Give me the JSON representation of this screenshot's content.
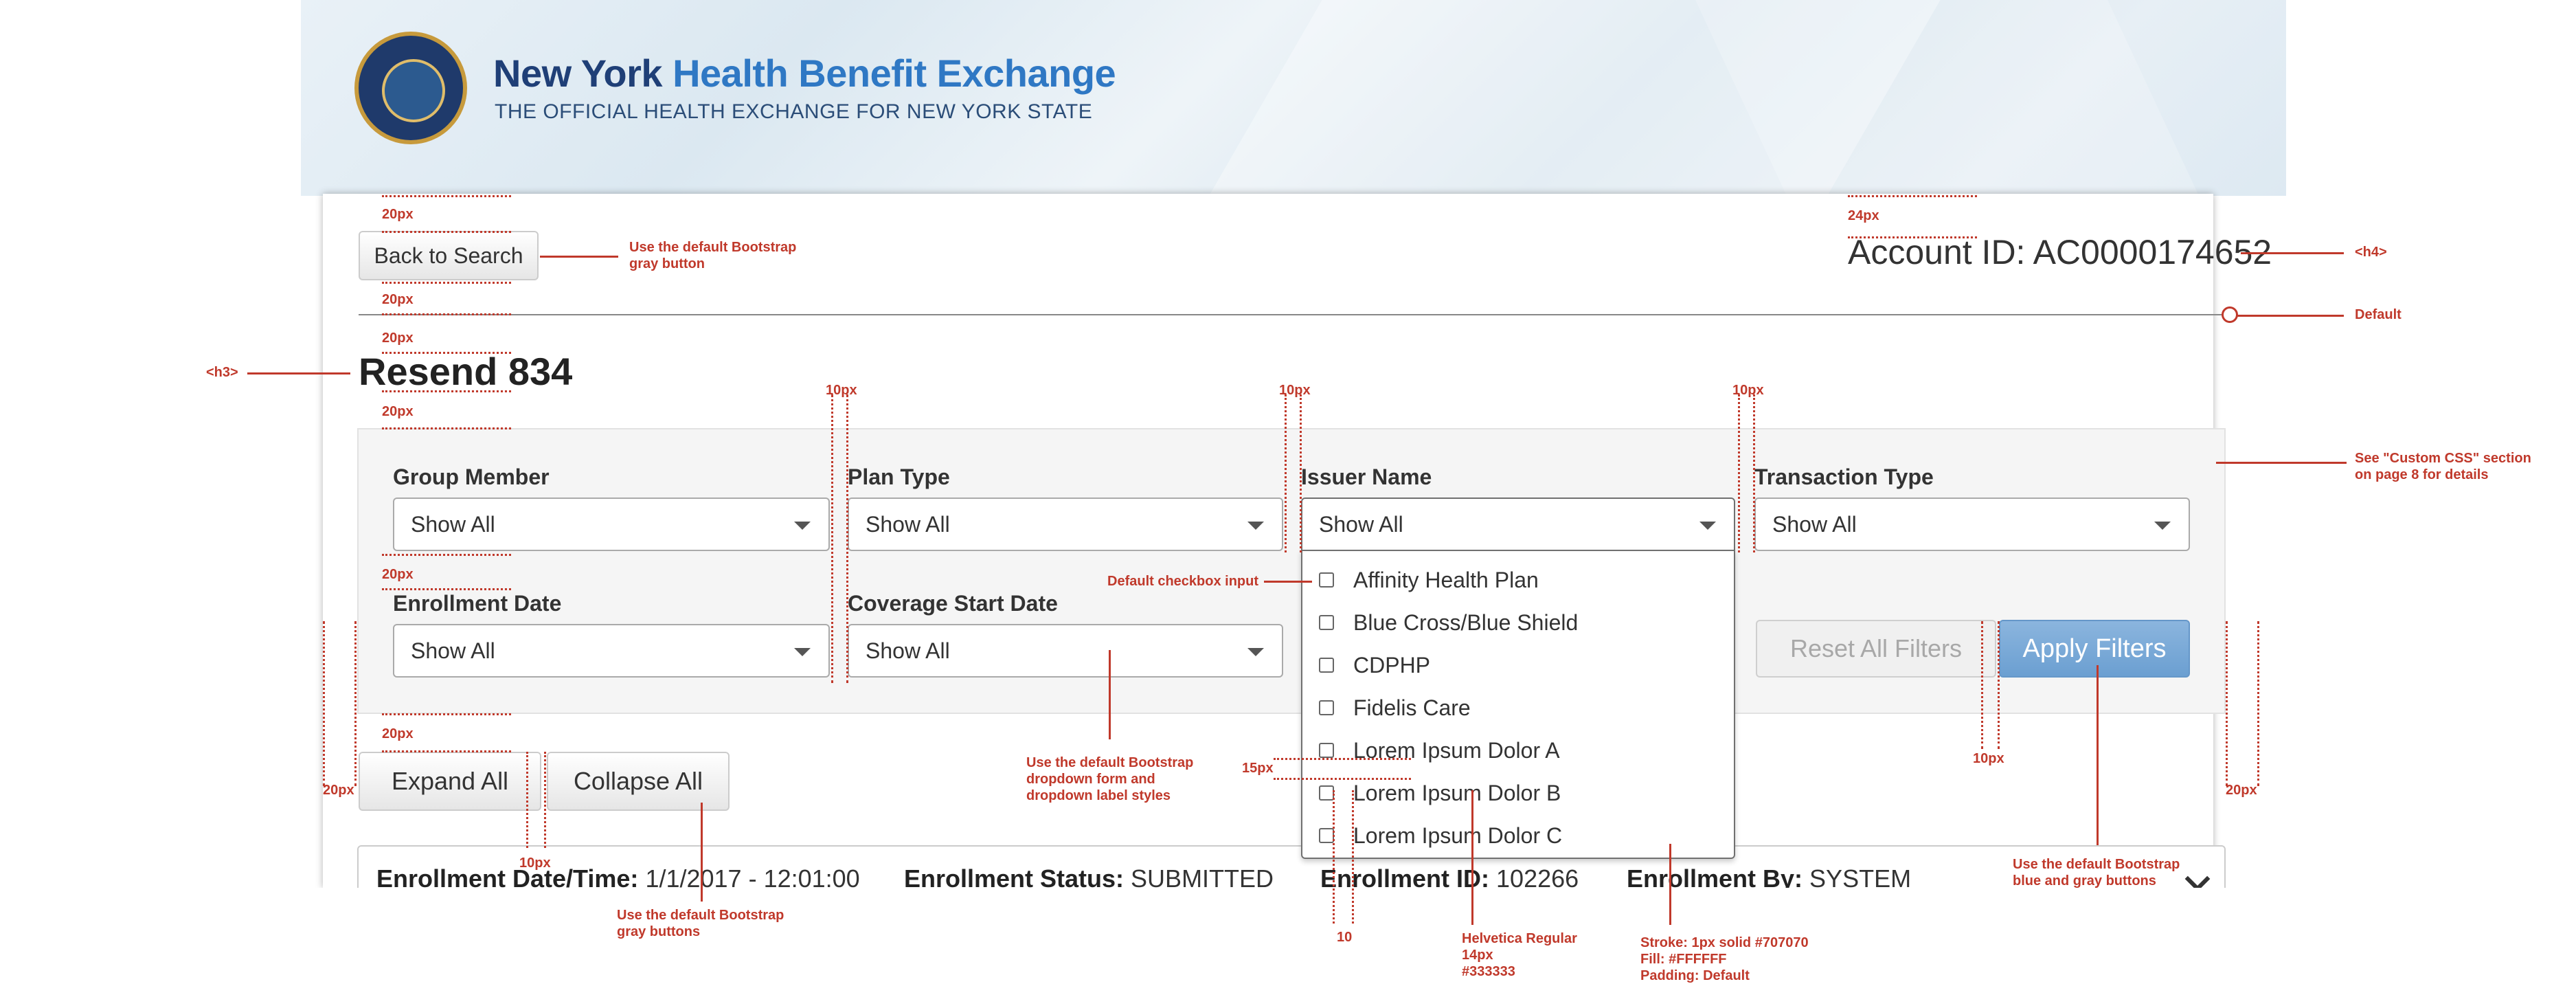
{
  "header": {
    "title_primary": "New York",
    "title_secondary": "Health Benefit Exchange",
    "subtitle": "THE OFFICIAL HEALTH EXCHANGE FOR NEW YORK STATE",
    "seal_icon": "ny-state-seal-icon"
  },
  "page": {
    "back_button": "Back to Search",
    "account_id": "Account ID: AC0000174652",
    "heading": "Resend 834"
  },
  "filters": {
    "group_member": {
      "label": "Group Member",
      "value": "Show All"
    },
    "plan_type": {
      "label": "Plan Type",
      "value": "Show All"
    },
    "issuer_name": {
      "label": "Issuer Name",
      "value": "Show All"
    },
    "transaction_type": {
      "label": "Transaction Type",
      "value": "Show All"
    },
    "enrollment_date": {
      "label": "Enrollment Date",
      "value": "Show All"
    },
    "coverage_start_date": {
      "label": "Coverage Start Date",
      "value": "Show All"
    },
    "reset_button": "Reset All Filters",
    "apply_button": "Apply Filters"
  },
  "issuer_options": [
    "Affinity Health Plan",
    "Blue Cross/Blue Shield",
    "CDPHP",
    "Fidelis Care",
    "Lorem Ipsum Dolor A",
    "Lorem Ipsum Dolor B",
    "Lorem Ipsum Dolor C"
  ],
  "actions": {
    "expand_all": "Expand All",
    "collapse_all": "Collapse All"
  },
  "enrollment": {
    "date_label": "Enrollment Date/Time:",
    "date_value": "1/1/2017 - 12:01:00",
    "status_label": "Enrollment Status:",
    "status_value": "SUBMITTED",
    "id_label": "Enrollment ID:",
    "id_value": "102266",
    "by_label": "Enrollment By:",
    "by_value": "SYSTEM"
  },
  "annotations": {
    "back_btn_note_1": "Use the default Bootstrap",
    "back_btn_note_2": "gray button",
    "h4": "<h4>",
    "default": "Default",
    "h3": "<h3>",
    "custom_css_1": "See \"Custom CSS\" section",
    "custom_css_2": "on page 8 for details",
    "checkbox_note": "Default checkbox input",
    "dropdown_note_1": "Use the default Bootstrap",
    "dropdown_note_2": "dropdown form and",
    "dropdown_note_3": "dropdown label styles",
    "gray_buttons_1": "Use the default Bootstrap",
    "gray_buttons_2": "gray buttons",
    "font_note_1": "Helvetica Regular",
    "font_note_2": "14px",
    "font_note_3": "#333333",
    "stroke_note_1": "Stroke: 1px solid #707070",
    "stroke_note_2": "Fill: #FFFFFF",
    "stroke_note_3": "Padding: Default",
    "blue_gray_1": "Use the default Bootstrap",
    "blue_gray_2": "blue and gray buttons",
    "px20": "20px",
    "px24": "24px",
    "px10": "10px",
    "px15": "15px",
    "n10": "10"
  },
  "colors": {
    "brand_dark": "#1f3f77",
    "brand_light": "#2f78c4",
    "annotation": "#c0392b",
    "dropdown_stroke": "#707070",
    "text": "#333333"
  }
}
